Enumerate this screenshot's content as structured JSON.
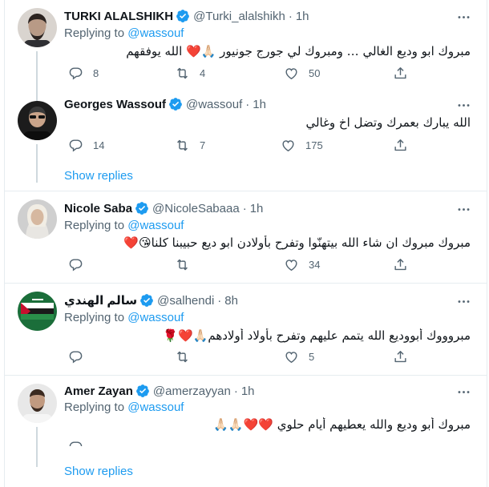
{
  "tweets": [
    {
      "name": "TURKI ALALSHIKH",
      "handle": "@Turki_alalshikh",
      "time": "1h",
      "replying_label": "Replying to",
      "replying_to": "@wassouf",
      "text": "مبروك ابو وديع الغالي … ومبروك لي جورج جونيور 🙏🏻❤️ الله يوفقهم",
      "replies": "8",
      "retweets": "4",
      "likes": "50",
      "avatar": "turki-avatar"
    },
    {
      "name": "Georges Wassouf",
      "handle": "@wassouf",
      "time": "1h",
      "text": "الله يبارك بعمرك وتضل اخ وغالي",
      "replies": "14",
      "retweets": "7",
      "likes": "175",
      "show_replies": "Show replies",
      "avatar": "wassouf-avatar"
    },
    {
      "name": "Nicole Saba",
      "handle": "@NicoleSabaaa",
      "time": "1h",
      "replying_label": "Replying to",
      "replying_to": "@wassouf",
      "text": "مبروك مبروك ان شاء الله بيتهنّوا وتفرح بأولادن ابو ديع حبيبنا كلنا😘❤️",
      "replies": "",
      "retweets": "",
      "likes": "34",
      "avatar": "nicole-avatar"
    },
    {
      "name": "سالم الهندي",
      "handle": "@salhendi",
      "time": "8h",
      "replying_label": "Replying to",
      "replying_to": "@wassouf",
      "text": "مبروووك أبووديع الله يتمم عليهم وتفرح بأولاد أولادهم🙏🏻❤️🌹",
      "replies": "",
      "retweets": "",
      "likes": "5",
      "avatar": "salem-avatar"
    },
    {
      "name": "Amer Zayan",
      "handle": "@amerzayyan",
      "time": "1h",
      "replying_label": "Replying to",
      "replying_to": "@wassouf",
      "text": "مبروك أبو وديع والله يعطيهم أيام حلوي ❤️❤️🙏🏻🙏🏻",
      "show_replies": "Show replies",
      "avatar": "amer-avatar"
    }
  ],
  "icons": {
    "verified": "verified-badge-icon",
    "more": "more-icon",
    "reply": "reply-icon",
    "retweet": "retweet-icon",
    "like": "like-icon",
    "share": "share-icon"
  },
  "colors": {
    "accent": "#1d9bf0",
    "secondary_text": "#536471",
    "divider": "#e6ecf0",
    "thread_line": "#cfd9de"
  }
}
